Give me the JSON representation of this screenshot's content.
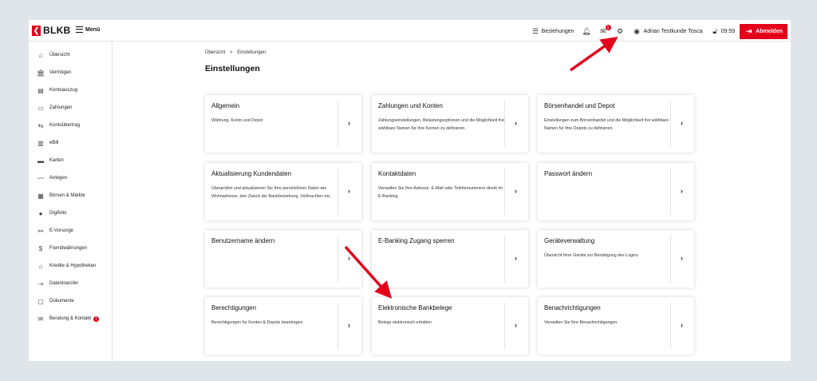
{
  "brand": {
    "name": "BLKB",
    "mark": "❮"
  },
  "topbar": {
    "menu_label": "Menü",
    "relations_label": "Beziehungen",
    "mail_badge": "1",
    "user_name": "Adrian Testkunde Tosca",
    "session_time": "09:59",
    "logout_label": "Abmelden",
    "colors": {
      "accent": "#e3001b"
    }
  },
  "sidebar": {
    "items": [
      {
        "label": "Übersicht",
        "icon": "home-icon"
      },
      {
        "label": "Vermögen",
        "icon": "bank-icon"
      },
      {
        "label": "Kontoauszug",
        "icon": "document-icon"
      },
      {
        "label": "Zahlungen",
        "icon": "payment-icon"
      },
      {
        "label": "Kontoübertrag",
        "icon": "transfer-icon"
      },
      {
        "label": "eBill",
        "icon": "ebill-icon"
      },
      {
        "label": "Karten",
        "icon": "card-icon"
      },
      {
        "label": "Anlegen",
        "icon": "chart-line-icon"
      },
      {
        "label": "Börsen & Märkte",
        "icon": "chart-bars-icon"
      },
      {
        "label": "Digifolio",
        "icon": "piggy-icon"
      },
      {
        "label": "E-Vorsorge",
        "icon": "pension-icon"
      },
      {
        "label": "Fremdwährungen",
        "icon": "dollar-icon"
      },
      {
        "label": "Kredite & Hypotheken",
        "icon": "house-loan-icon"
      },
      {
        "label": "Datentransfer",
        "icon": "data-transfer-icon"
      },
      {
        "label": "Dokumente",
        "icon": "file-icon"
      },
      {
        "label": "Beratung & Kontakt",
        "icon": "mail-icon",
        "badge": "1"
      }
    ]
  },
  "breadcrumb": {
    "parent": "Übersicht",
    "separator": ">",
    "current": "Einstellungen"
  },
  "page_title": "Einstellungen",
  "cards": [
    {
      "title": "Allgemein",
      "desc": "Währung, Konto und Depot"
    },
    {
      "title": "Zahlungen und Konten",
      "desc": "Zahlungseinstellungen, Belastungsoptionen und die Möglichkeit frei wählbare Namen für Ihre Konten zu definieren."
    },
    {
      "title": "Börsenhandel und Depot",
      "desc": "Einstellungen zum Börsenhandel und die Möglichkeit frei wählbare Namen für Ihre Depots zu definieren."
    },
    {
      "title": "Aktualisierung Kundendaten",
      "desc": "Überprüfen und aktualisieren Sie Ihre persönlichen Daten wie Wohnadresse, den Zweck der Bankbeziehung, Vollmachten etc."
    },
    {
      "title": "Kontaktdaten",
      "desc": "Verwalten Sie Ihre Adresse, E-Mail oder Telefonnummern direkt im E-Banking."
    },
    {
      "title": "Passwort ändern",
      "desc": ""
    },
    {
      "title": "Benutzername ändern",
      "desc": ""
    },
    {
      "title": "E-Banking Zugang sperren",
      "desc": ""
    },
    {
      "title": "Geräteverwaltung",
      "desc": "Übersicht Ihrer Geräte zur Bestätigung des Logins"
    },
    {
      "title": "Berechtigungen",
      "desc": "Berechtigungen für Konten & Depots beantragen"
    },
    {
      "title": "Elektronische Bankbelege",
      "desc": "Belege elektronisch erhalten"
    },
    {
      "title": "Benachrichtigungen",
      "desc": "Verwalten Sie Ihre Benachrichtigungen."
    }
  ],
  "annotation_color": "#e3001b"
}
